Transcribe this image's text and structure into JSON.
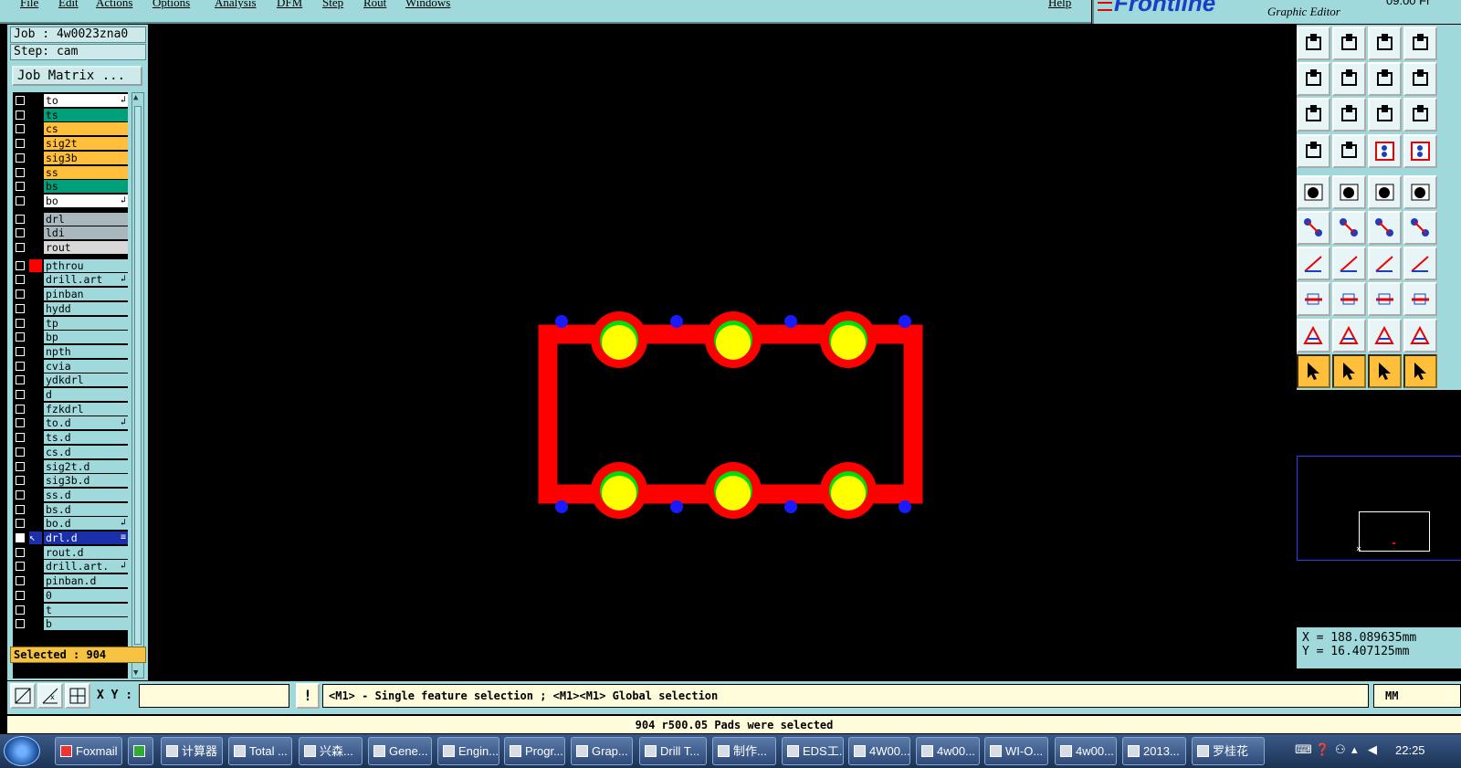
{
  "menu": {
    "items": [
      "File",
      "Edit",
      "Actions",
      "Options",
      "Analysis",
      "DFM",
      "Step",
      "Rout",
      "Windows"
    ],
    "help": "Help"
  },
  "brand": {
    "logo": "Frontline",
    "subtitle": "Graphic Editor",
    "clock_fragment": "09:00 Fr"
  },
  "job": {
    "job_label": "Job : 4w0023zna0",
    "step_label": "Step: cam",
    "matrix_button": "Job Matrix ..."
  },
  "layers": [
    {
      "name": "to",
      "color": "#ffffff",
      "ind": "↲"
    },
    {
      "name": "ts",
      "color": "#00a07a",
      "ind": ""
    },
    {
      "name": "cs",
      "color": "#ffbf3a",
      "ind": ""
    },
    {
      "name": "sig2t",
      "color": "#ffbf3a",
      "ind": ""
    },
    {
      "name": "sig3b",
      "color": "#ffbf3a",
      "ind": ""
    },
    {
      "name": "ss",
      "color": "#ffbf3a",
      "ind": ""
    },
    {
      "name": "bs",
      "color": "#00a07a",
      "ind": ""
    },
    {
      "name": "bo",
      "color": "#ffffff",
      "ind": "↲"
    },
    {
      "name": "drl",
      "color": "#a9b8bc",
      "ind": "",
      "gap": true
    },
    {
      "name": "ldi",
      "color": "#a9b8bc",
      "ind": ""
    },
    {
      "name": "rout",
      "color": "#d8d8d8",
      "ind": ""
    },
    {
      "name": "pthrou",
      "color": "#9fd9dc",
      "ind": "",
      "gap": true,
      "mark": "#ff0000"
    },
    {
      "name": "drill.art",
      "color": "#9fd9dc",
      "ind": "↲"
    },
    {
      "name": "pinban",
      "color": "#9fd9dc",
      "ind": ""
    },
    {
      "name": "hydd",
      "color": "#9fd9dc",
      "ind": ""
    },
    {
      "name": "tp",
      "color": "#9fd9dc",
      "ind": ""
    },
    {
      "name": "bp",
      "color": "#9fd9dc",
      "ind": ""
    },
    {
      "name": "npth",
      "color": "#9fd9dc",
      "ind": ""
    },
    {
      "name": "cvia",
      "color": "#9fd9dc",
      "ind": ""
    },
    {
      "name": "ydkdrl",
      "color": "#9fd9dc",
      "ind": ""
    },
    {
      "name": "d",
      "color": "#9fd9dc",
      "ind": ""
    },
    {
      "name": "fzkdrl",
      "color": "#9fd9dc",
      "ind": ""
    },
    {
      "name": "to.d",
      "color": "#9fd9dc",
      "ind": "↲"
    },
    {
      "name": "ts.d",
      "color": "#9fd9dc",
      "ind": ""
    },
    {
      "name": "cs.d",
      "color": "#9fd9dc",
      "ind": ""
    },
    {
      "name": "sig2t.d",
      "color": "#9fd9dc",
      "ind": ""
    },
    {
      "name": "sig3b.d",
      "color": "#9fd9dc",
      "ind": ""
    },
    {
      "name": "ss.d",
      "color": "#9fd9dc",
      "ind": ""
    },
    {
      "name": "bs.d",
      "color": "#9fd9dc",
      "ind": ""
    },
    {
      "name": "bo.d",
      "color": "#9fd9dc",
      "ind": "↲"
    },
    {
      "name": "drl.d",
      "color": "#1a2fa8",
      "ind": "≡",
      "active": true
    },
    {
      "name": "rout.d",
      "color": "#9fd9dc",
      "ind": ""
    },
    {
      "name": "drill.art.",
      "color": "#9fd9dc",
      "ind": "↲"
    },
    {
      "name": "pinban.d",
      "color": "#9fd9dc",
      "ind": ""
    },
    {
      "name": "0",
      "color": "#9fd9dc",
      "ind": ""
    },
    {
      "name": "t",
      "color": "#9fd9dc",
      "ind": ""
    },
    {
      "name": "b",
      "color": "#9fd9dc",
      "ind": ""
    }
  ],
  "selected_label": "Selected : 904",
  "coords": {
    "x": "X = 188.089635mm",
    "y": "Y = 16.407125mm"
  },
  "bottom": {
    "xy_label": "X Y :",
    "xy_value": "",
    "warn": "!",
    "hint": "<M1> - Single feature selection ; <M1><M1> Global selection",
    "units": "MM"
  },
  "status": "904 r500.05 Pads were selected",
  "canvas": {
    "outline_color": "#ff0000",
    "pad_fill": "#ffff00",
    "pad_ring": "#00dd00",
    "via_color": "#1a1aff"
  },
  "taskbar": {
    "items": [
      "Foxmail",
      "",
      "计算器",
      "Total ...",
      "兴森...",
      "Gene...",
      "Engin...",
      "Progr...",
      "Grap...",
      "Drill T...",
      "制作...",
      "EDS工...",
      "4W00...",
      "4w00...",
      "WI-O...",
      "4w00...",
      "2013...",
      "罗桂花"
    ],
    "clock": "22:25"
  }
}
